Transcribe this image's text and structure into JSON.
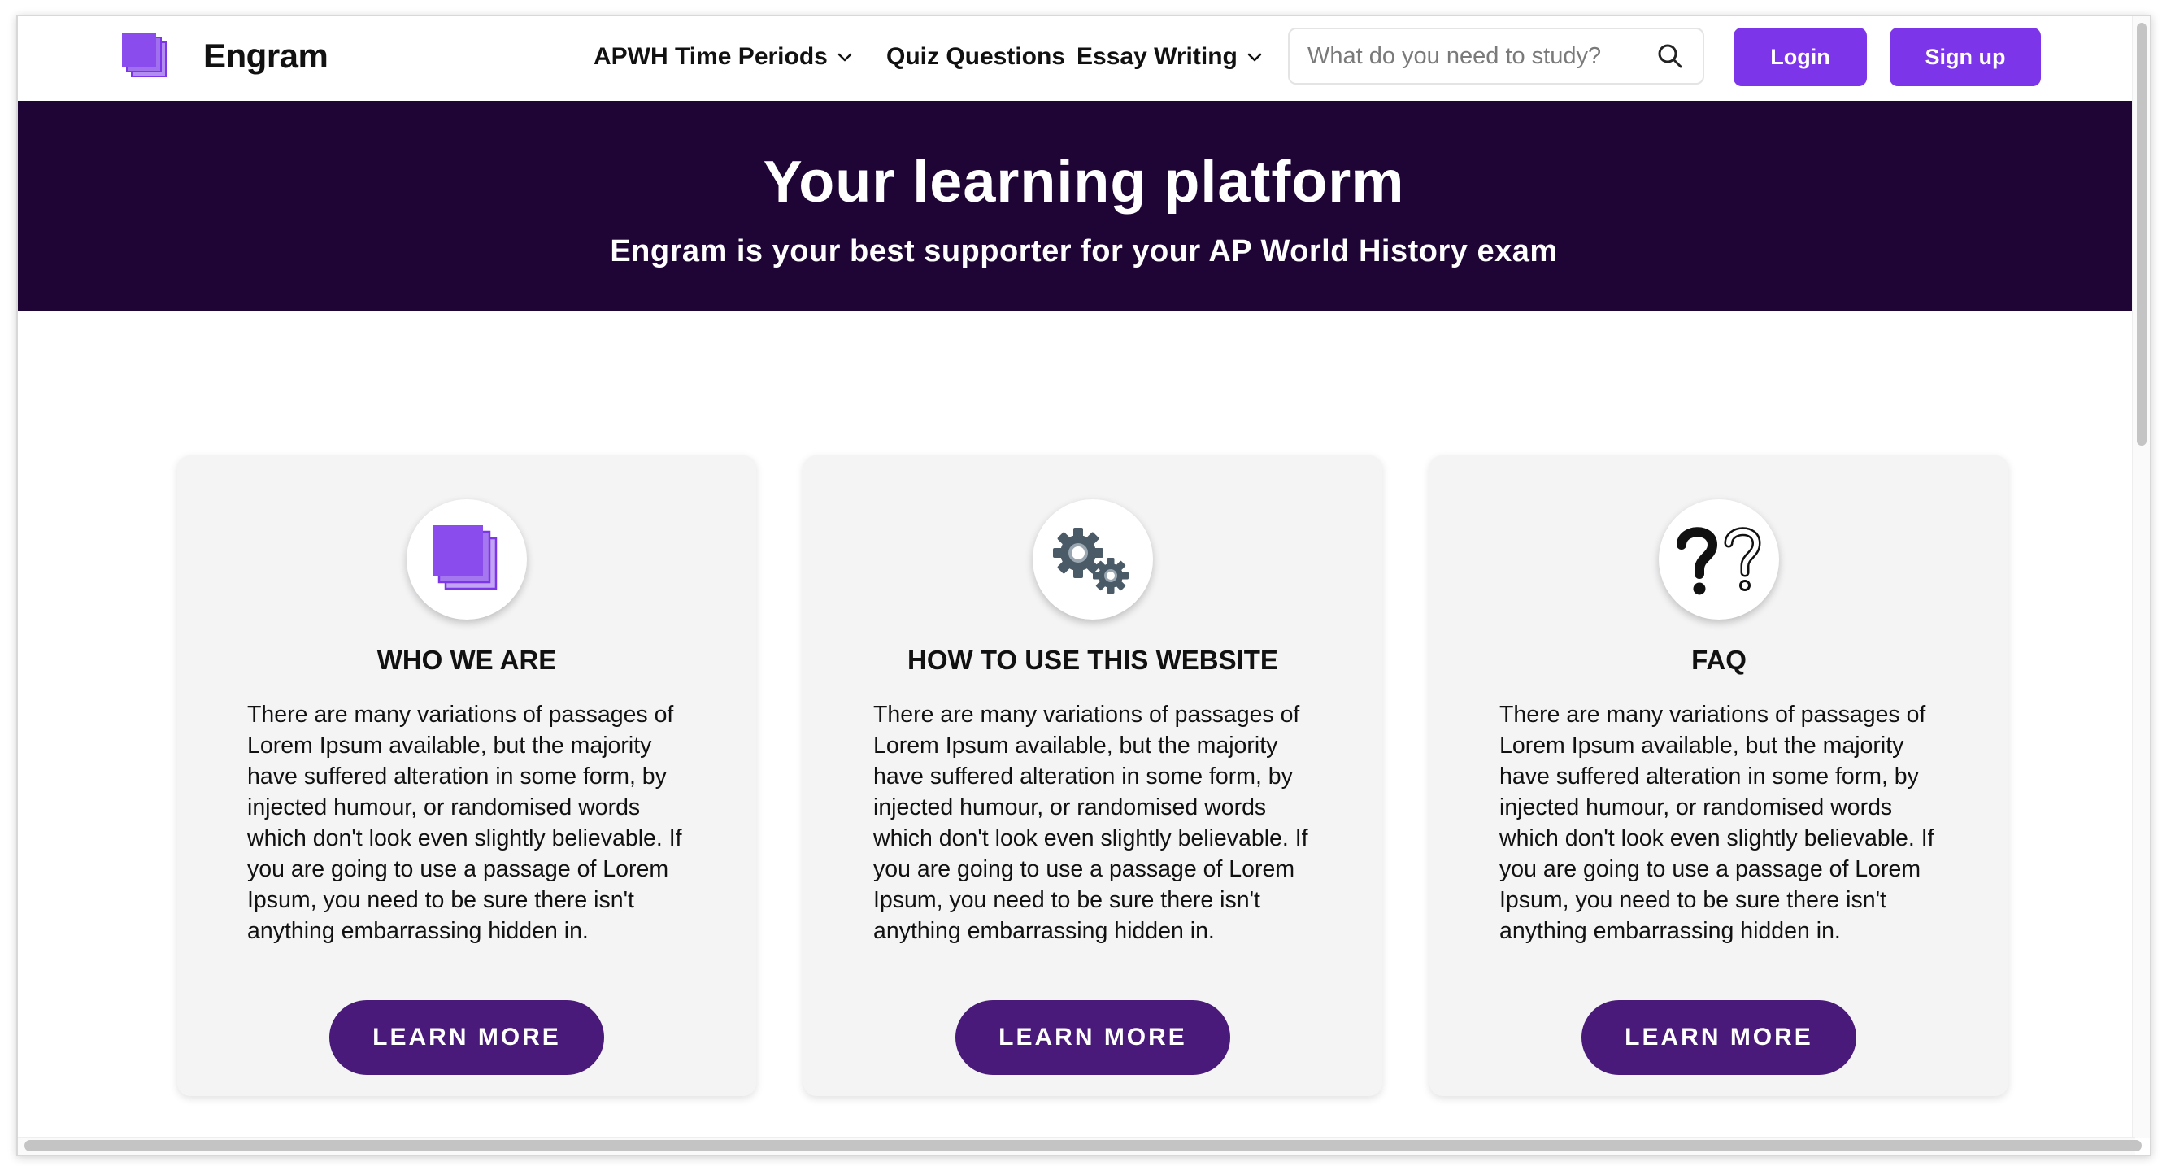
{
  "brand": {
    "name": "Engram"
  },
  "nav": {
    "time_periods": "APWH Time Periods",
    "quiz": "Quiz Questions",
    "essay": "Essay Writing",
    "search_placeholder": "What do you need to study?",
    "login": "Login",
    "signup": "Sign up"
  },
  "hero": {
    "title": "Your learning platform",
    "subtitle": "Engram is your best supporter for your AP World History exam"
  },
  "cards": [
    {
      "icon": "layers-icon",
      "title": "WHO WE ARE",
      "text": "There are many variations of passages of Lorem Ipsum available, but the majority have suffered alteration in some form, by injected humour, or randomised words which don't look even slightly believable. If you are going to use a passage of Lorem Ipsum, you need to be sure there isn't anything embarrassing hidden in.",
      "button": "LEARN MORE"
    },
    {
      "icon": "gears-icon",
      "title": "HOW TO USE THIS WEBSITE",
      "text": "There are many variations of passages of Lorem Ipsum available, but the majority have suffered alteration in some form, by injected humour, or randomised words which don't look even slightly believable. If you are going to use a passage of Lorem Ipsum, you need to be sure there isn't anything embarrassing hidden in.",
      "button": "LEARN MORE"
    },
    {
      "icon": "question-marks-icon",
      "title": "FAQ",
      "text": "There are many variations of passages of Lorem Ipsum available, but the majority have suffered alteration in some form, by injected humour, or randomised words which don't look even slightly believable. If you are going to use a passage of Lorem Ipsum, you need to be sure there isn't anything embarrassing hidden in.",
      "button": "LEARN MORE"
    }
  ],
  "colors": {
    "accent": "#7c35e8",
    "hero_bg": "#1e0535",
    "card_button": "#4a1a7a",
    "card_bg": "#f4f4f5"
  }
}
